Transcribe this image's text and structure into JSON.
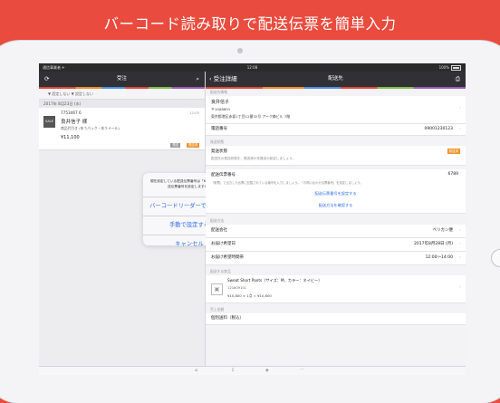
{
  "headline": "バーコード読み取りで配送伝票を簡単入力",
  "statusbar": {
    "carrier": "通信事業者 ✈",
    "time": "12:08",
    "battery": "100%"
  },
  "left": {
    "nav_title": "受注",
    "refresh_icon": "refresh-icon",
    "search_icon": "search-icon",
    "filter_text": "▼ 設定しない ▼ 設定しない",
    "date_header": "2017年 8月23日 (水)",
    "order": {
      "thumb": "SALE",
      "id": "7753467 6",
      "time": "12:05",
      "name": "良井信子 様",
      "item": "商品代引き (ゆうパック・ゆうメール)",
      "price": "¥11,100",
      "badge_gray": "発送",
      "badge_orange": "発送済"
    }
  },
  "alert": {
    "message": "現在設定している配送伝票番号は「6789」です。配送伝票番号を設定しますか？",
    "options": [
      "バーコードリーダーで設定する",
      "手動で設定する",
      "キャンセル"
    ]
  },
  "right": {
    "back_label": "受注詳細",
    "nav_title": "配送先",
    "print_icon": "printer-icon",
    "address_hdr": "配送先情報",
    "recipient_name": "良井信子",
    "postal": "〒1008801",
    "address": "東京都港区赤坂1丁目12番32号 アーク森ビル 7階",
    "phone_label": "電話番号",
    "phone_value": "09001230123",
    "status_hdr": "発送状態",
    "status_label": "発送状態",
    "status_badge": "発送済",
    "status_note": "配送先の発送状態を、発送済か未発送か設定しましょう。",
    "slip_label": "配送伝票番号",
    "slip_value": "6789",
    "slip_note": "「帳票」で出力した伝票に記載されている番号を入力しましょう。「お問い合わせ伝票番号」を設定しましょう。",
    "slip_link1": "配送伝票番号を設定する",
    "slip_link2": "配送方法を確認する",
    "delivery_hdr": "配送方法",
    "delivery_rows": [
      {
        "label": "配送会社",
        "value": "ペリカン便"
      },
      {
        "label": "お届け希望日",
        "value": "2017年8月28日 (月)"
      },
      {
        "label": "お届け希望時間帯",
        "value": "12:00〜14:00"
      }
    ],
    "items_hdr": "配送する商品",
    "product": {
      "name": "Sweat Short Pants（サイズ：M、カラー：ネイビー）",
      "code": "121809101",
      "calc": "¥10,800 × 1点 = ¥10,800"
    },
    "shipping_hdr": "売上金額",
    "shipping_label": "個別送料（税込）"
  }
}
